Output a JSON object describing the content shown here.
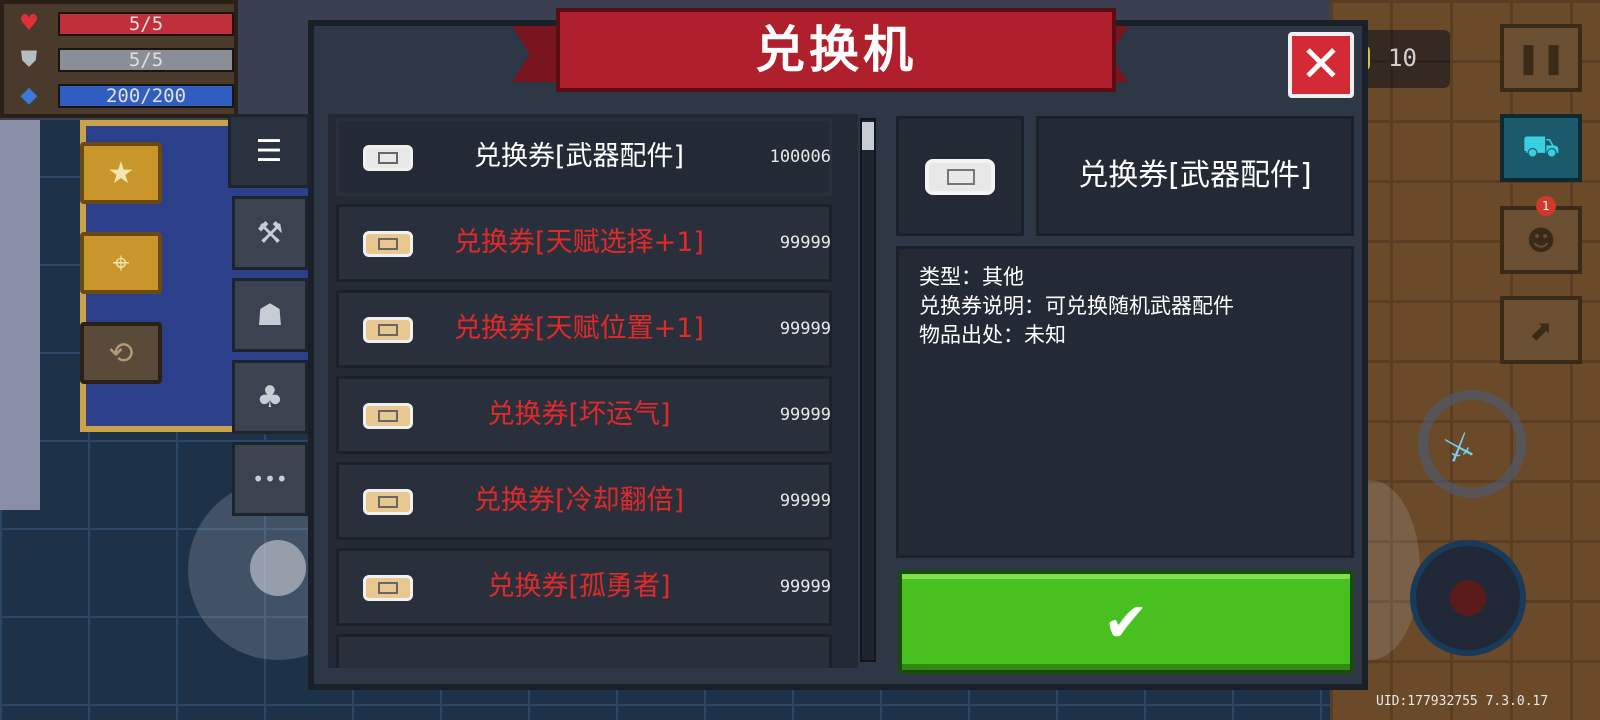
{
  "hud": {
    "health": "5/5",
    "armor": "5/5",
    "energy": "200/200"
  },
  "coins": "10",
  "notification_badge": "1",
  "uid_version": "UID:177932755  7.3.0.17",
  "dialog": {
    "title": "兑换机",
    "close_icon": "✕",
    "confirm_icon": "✔",
    "tabs": [
      {
        "icon": "list-icon",
        "glyph": "☰"
      },
      {
        "icon": "weapon-icon",
        "glyph": "⚒"
      },
      {
        "icon": "talent-icon",
        "glyph": "☗"
      },
      {
        "icon": "plant-icon",
        "glyph": "♣"
      },
      {
        "icon": "more-icon",
        "glyph": "•••"
      }
    ],
    "items": [
      {
        "name": "兑换券[武器配件]",
        "count": "100006",
        "color": "#ffffff",
        "selected": true
      },
      {
        "name": "兑换券[天赋选择+1]",
        "count": "99999",
        "color": "#e02a2a",
        "selected": false
      },
      {
        "name": "兑换券[天赋位置+1]",
        "count": "99999",
        "color": "#e02a2a",
        "selected": false
      },
      {
        "name": "兑换券[坏运气]",
        "count": "99999",
        "color": "#e02a2a",
        "selected": false
      },
      {
        "name": "兑换券[冷却翻倍]",
        "count": "99999",
        "color": "#e02a2a",
        "selected": false
      },
      {
        "name": "兑换券[孤勇者]",
        "count": "99999",
        "color": "#e02a2a",
        "selected": false
      }
    ],
    "detail": {
      "name": "兑换券[武器配件]",
      "type_line": "类型：其他",
      "desc_line": "兑换券说明：可兑换随机武器配件",
      "source_line": "物品出处：未知"
    }
  }
}
